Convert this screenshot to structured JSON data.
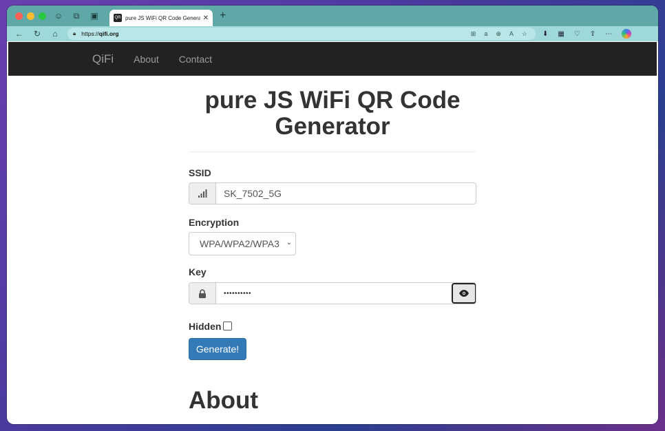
{
  "browser": {
    "tab_title": "pure JS WiFi QR Code Generator",
    "tab_favicon_text": "QR",
    "url_prefix": "https://",
    "url_domain": "qifi.org",
    "icons": [
      "back-icon",
      "refresh-icon",
      "home-icon",
      "lock-icon",
      "reader-icon",
      "translate-icon",
      "zoom-icon",
      "read-aloud-icon",
      "favorite-icon",
      "extension-icon",
      "collections-icon",
      "browser-essentials-icon",
      "share-icon",
      "more-icon",
      "copilot-icon"
    ]
  },
  "navbar": {
    "brand": "QiFi",
    "links": [
      "About",
      "Contact"
    ]
  },
  "form": {
    "title": "pure JS WiFi QR Code Generator",
    "ssid_label": "SSID",
    "ssid_value": "SK_7502_5G",
    "encryption_label": "Encryption",
    "encryption_value": "WPA/WPA2/WPA3",
    "key_label": "Key",
    "key_value": "••••••••••",
    "hidden_label": "Hidden",
    "hidden_checked": false,
    "generate_label": "Generate!"
  },
  "about": {
    "heading": "About"
  }
}
